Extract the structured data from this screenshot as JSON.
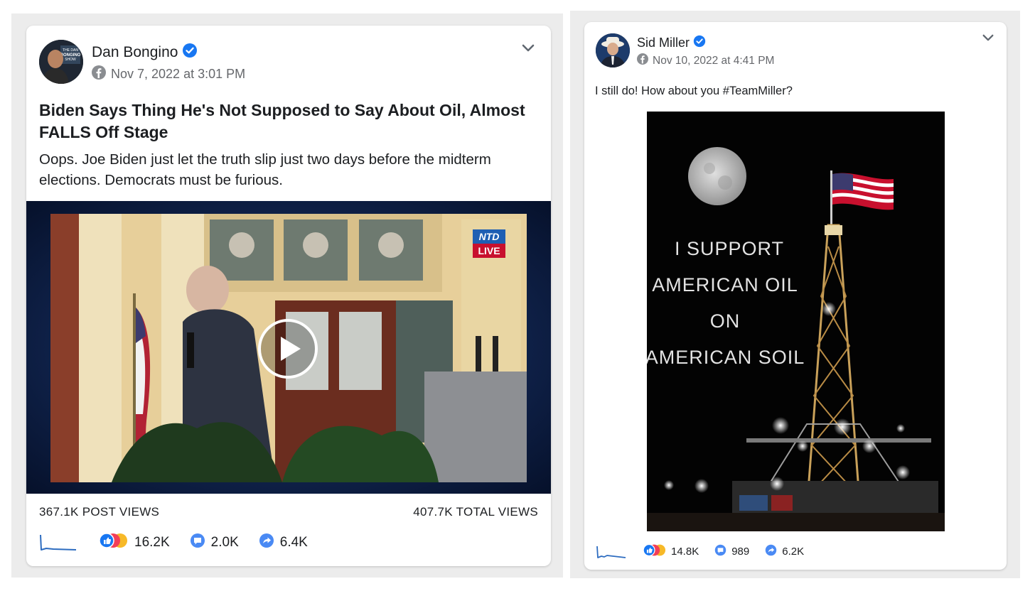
{
  "left_post": {
    "author": "Dan Bongino",
    "timestamp": "Nov 7, 2022 at 3:01 PM",
    "headline": "Biden Says Thing He's Not Supposed to Say About Oil, Almost FALLS Off Stage",
    "description": "Oops. Joe Biden just let the truth slip just two days before the midterm elections. Democrats must be furious.",
    "video_badge_top": "NTD",
    "video_badge_bottom": "LIVE",
    "post_views": "367.1K POST VIEWS",
    "total_views": "407.7K TOTAL VIEWS",
    "reactions": "16.2K",
    "comments": "2.0K",
    "shares": "6.4K"
  },
  "right_post": {
    "author": "Sid Miller",
    "timestamp": "Nov 10, 2022 at 4:41 PM",
    "text": "I still do! How about you #TeamMiller?",
    "poster_lines": [
      "I  SUPPORT",
      "AMERICAN OIL",
      "ON",
      "AMERICAN SOIL"
    ],
    "reactions": "14.8K",
    "comments": "989",
    "shares": "6.2K"
  },
  "colors": {
    "verified_blue": "#1877f2",
    "meta_gray": "#65676b",
    "sparkline_blue": "#2d6cc0"
  },
  "icons": [
    "verified-badge-icon",
    "facebook-globe-icon",
    "chevron-down-icon",
    "play-icon",
    "like-reaction-icon",
    "comment-icon",
    "share-icon",
    "sparkline-icon"
  ]
}
